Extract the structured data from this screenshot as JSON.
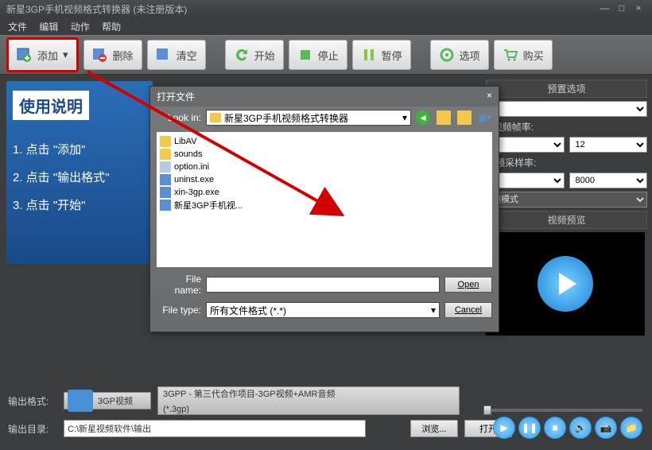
{
  "title": "新星3GP手机视频格式转换器   (未注册版本)",
  "menu": {
    "file": "文件",
    "edit": "编辑",
    "action": "动作",
    "help": "帮助"
  },
  "toolbar": {
    "add": "添加",
    "delete": "删除",
    "clear": "清空",
    "start": "开始",
    "stop": "停止",
    "pause": "暂停",
    "options": "选项",
    "buy": "购买"
  },
  "instructions": {
    "title": "使用说明",
    "step1": "1. 点击 \"添加\"",
    "step2": "2. 点击 \"输出格式\"",
    "step3": "3. 点击 \"开始\""
  },
  "right": {
    "preset_label": "预置选项",
    "fps_label": "视频帧率:",
    "fps_value": "12",
    "audio_label": "音频采样率:",
    "audio_value": "8000",
    "mode_value": "频模式",
    "preview_label": "视频预览"
  },
  "bottom": {
    "format_label": "输出格式:",
    "format_name": "3GP视频",
    "format_desc": "3GPP -   第三代合作项目-3GP视频+AMR音频",
    "format_ext": "(*.3gp)",
    "dir_label": "输出目录:",
    "dir_value": "C:\\新星视频软件\\输出",
    "browse": "浏览...",
    "open": "打开"
  },
  "dialog": {
    "title": "打开文件",
    "lookin_label": "Look in:",
    "lookin_value": "新星3GP手机视频格式转换器",
    "files": [
      {
        "name": "LibAV",
        "type": "folder"
      },
      {
        "name": "sounds",
        "type": "folder"
      },
      {
        "name": "option.ini",
        "type": "ini"
      },
      {
        "name": "uninst.exe",
        "type": "exe"
      },
      {
        "name": "xin-3gp.exe",
        "type": "exe"
      },
      {
        "name": "新星3GP手机视...",
        "type": "exe"
      }
    ],
    "filename_label": "File name:",
    "filetype_label": "File type:",
    "filetype_value": "所有文件格式 (*.*)",
    "open_btn": "Open",
    "cancel_btn": "Cancel"
  }
}
